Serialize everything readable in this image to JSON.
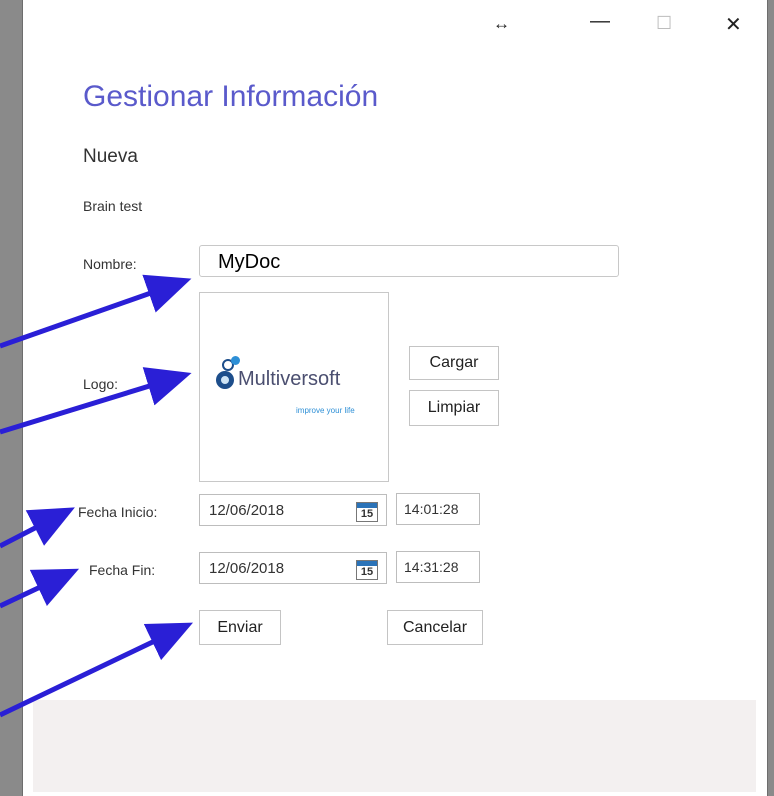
{
  "window": {
    "resize_glyph": "↔",
    "minimize_glyph": "—",
    "maximize_glyph": "☐",
    "close_glyph": "✕"
  },
  "page": {
    "title": "Gestionar Información",
    "subtitle": "Nueva",
    "context": "Brain test"
  },
  "form": {
    "name_label": "Nombre:",
    "name_value": "MyDoc",
    "logo_label": "Logo:",
    "logo_brand": "Multiversoft",
    "logo_tagline": "improve your life",
    "load_button": "Cargar",
    "clear_button": "Limpiar",
    "start_label": "Fecha Inicio:",
    "start_date": "12/06/2018",
    "start_time": "14:01:28",
    "end_label": "Fecha Fin:",
    "end_date": "12/06/2018",
    "end_time": "14:31:28",
    "calendar_day": "15",
    "submit_button": "Enviar",
    "cancel_button": "Cancelar"
  },
  "colors": {
    "title": "#5a5acb",
    "arrow": "#2a1fd6",
    "background": "#8a8a8a",
    "footer": "#f3f0f0"
  },
  "icons": [
    "resize-icon",
    "minimize-icon",
    "maximize-icon",
    "close-icon",
    "calendar-icon",
    "arrow-annotation"
  ]
}
